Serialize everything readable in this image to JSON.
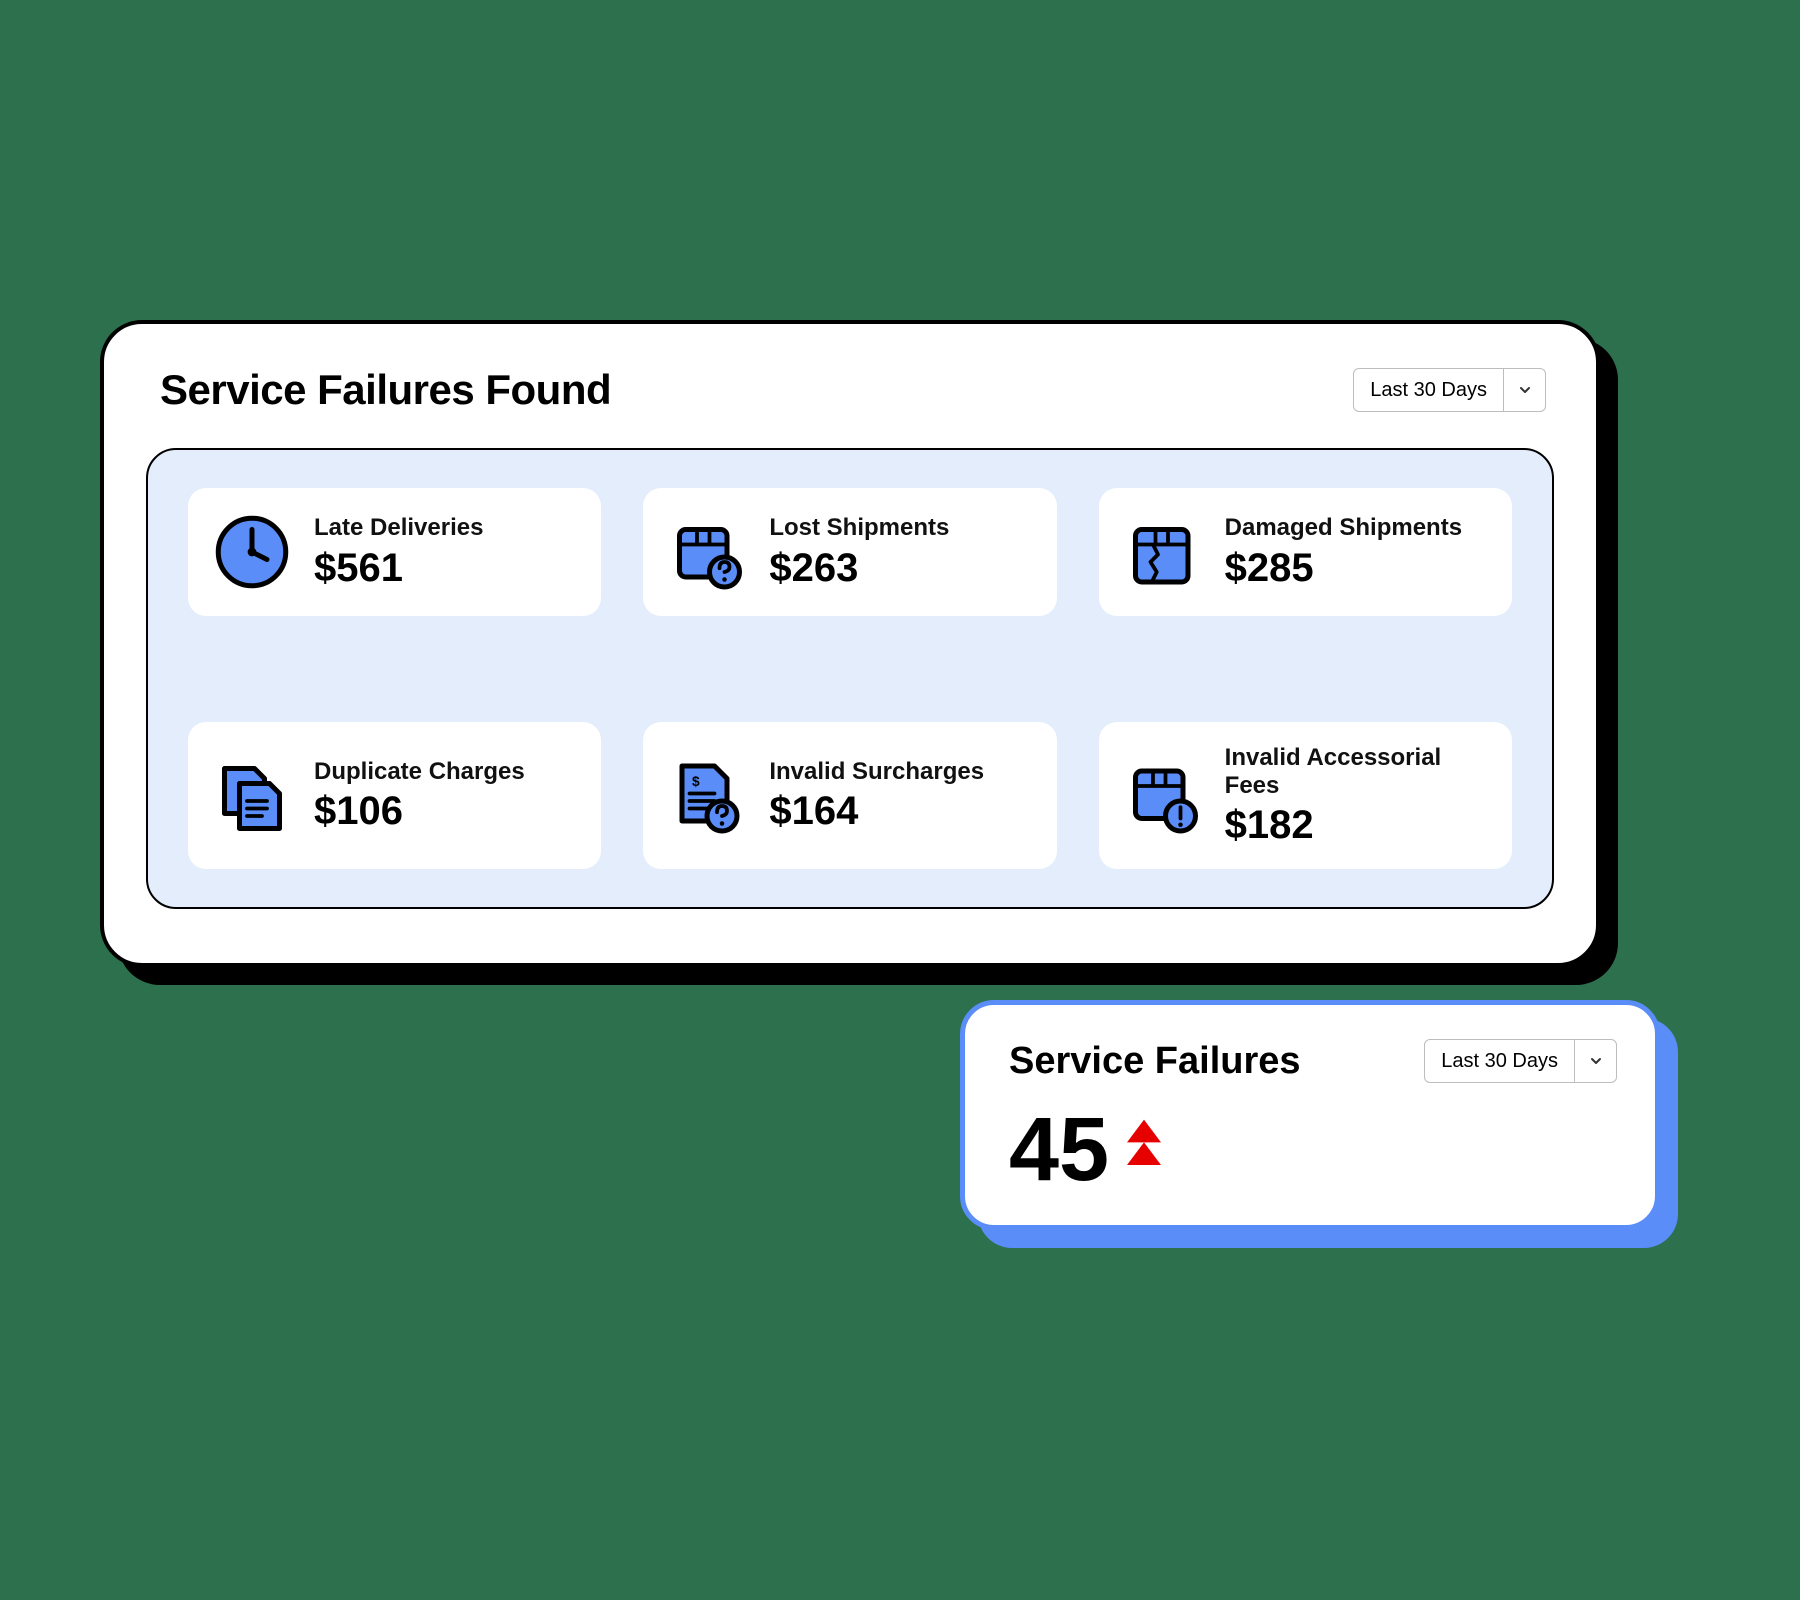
{
  "colors": {
    "iconFill": "#5a8df8",
    "stroke": "#000000",
    "trendUp": "#e60000",
    "pageBg": "#2c704d",
    "gridBg": "#e3edfb",
    "miniBorder": "#5a8df8"
  },
  "main": {
    "title": "Service Failures Found",
    "dropdown": {
      "selected": "Last 30 Days"
    },
    "cards": [
      {
        "icon": "clock",
        "label": "Late Deliveries",
        "value": "$561"
      },
      {
        "icon": "box-question",
        "label": "Lost Shipments",
        "value": "$263"
      },
      {
        "icon": "box-damaged",
        "label": "Damaged Shipments",
        "value": "$285"
      },
      {
        "icon": "docs-duplicate",
        "label": "Duplicate Charges",
        "value": "$106"
      },
      {
        "icon": "invoice-question",
        "label": "Invalid Surcharges",
        "value": "$164"
      },
      {
        "icon": "box-alert",
        "label": "Invalid Accessorial Fees",
        "value": "$182"
      }
    ]
  },
  "mini": {
    "title": "Service Failures",
    "dropdown": {
      "selected": "Last 30 Days"
    },
    "value": "45",
    "trend": "up"
  }
}
